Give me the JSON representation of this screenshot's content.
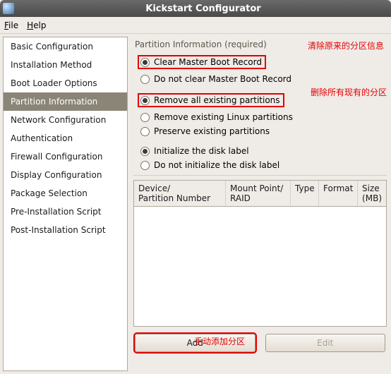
{
  "window": {
    "title": "Kickstart Configurator"
  },
  "menubar": {
    "file": "File",
    "help": "Help"
  },
  "sidebar": {
    "items": [
      {
        "label": "Basic Configuration"
      },
      {
        "label": "Installation Method"
      },
      {
        "label": "Boot Loader Options"
      },
      {
        "label": "Partition Information"
      },
      {
        "label": "Network Configuration"
      },
      {
        "label": "Authentication"
      },
      {
        "label": "Firewall Configuration"
      },
      {
        "label": "Display Configuration"
      },
      {
        "label": "Package Selection"
      },
      {
        "label": "Pre-Installation Script"
      },
      {
        "label": "Post-Installation Script"
      }
    ],
    "selected_index": 3
  },
  "main": {
    "section_title": "Partition Information (required)",
    "mbr": {
      "clear": "Clear Master Boot Record",
      "noclear": "Do not clear Master Boot Record",
      "selected": "clear"
    },
    "remove": {
      "all": "Remove all existing partitions",
      "linux": "Remove existing Linux partitions",
      "preserve": "Preserve existing partitions",
      "selected": "all"
    },
    "init": {
      "init": "Initialize the disk label",
      "noinit": "Do not initialize the disk label",
      "selected": "init"
    },
    "table": {
      "col1a": "Device/",
      "col1b": "Partition Number",
      "col2a": "Mount Point/",
      "col2b": "RAID",
      "col3": "Type",
      "col4": "Format",
      "col5": "Size (MB)"
    },
    "buttons": {
      "add": "Add",
      "edit": "Edit"
    }
  },
  "annotations": {
    "a1": "清除原来的分区信息",
    "a2": "删除所有现有的分区",
    "a3": "手动添加分区"
  }
}
